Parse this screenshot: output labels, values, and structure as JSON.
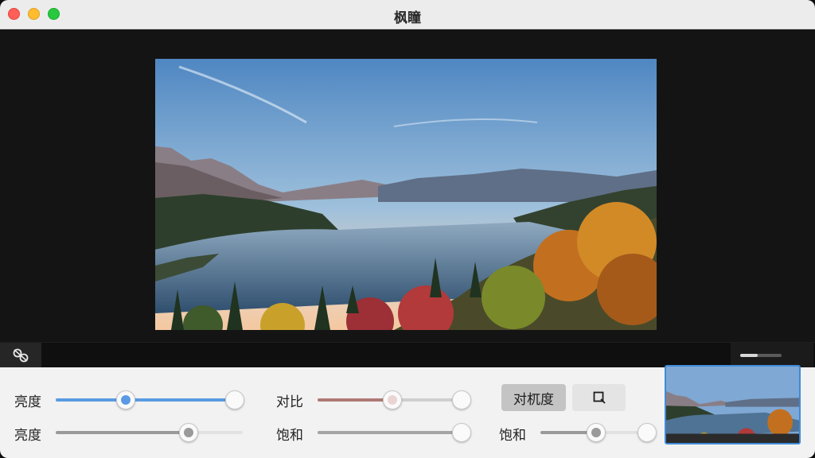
{
  "window": {
    "title": "枫瞳"
  },
  "photo": {
    "alt": "autumn-lake-landscape"
  },
  "toolbar": {
    "tool_icon": "adjust-tool-icon",
    "zoom_level": 0.42
  },
  "controls": {
    "row1": {
      "brightness": {
        "label": "亮度",
        "value": 0.4
      },
      "contrast": {
        "label": "对比",
        "value": 0.45
      }
    },
    "row2": {
      "brightness": {
        "label": "亮度",
        "value": 0.71
      },
      "saturation": {
        "label": "饱和"
      },
      "saturation2": {
        "label": "饱和",
        "value": 0.55
      }
    },
    "buttons": {
      "contrast_label": "对杌度",
      "crop_icon": "crop-icon"
    }
  },
  "colors": {
    "accent": "#3e8bd9",
    "contrast_track": "#b07a75",
    "close": "#ff5f57",
    "minimize": "#febc2e",
    "maximize": "#28c840"
  }
}
